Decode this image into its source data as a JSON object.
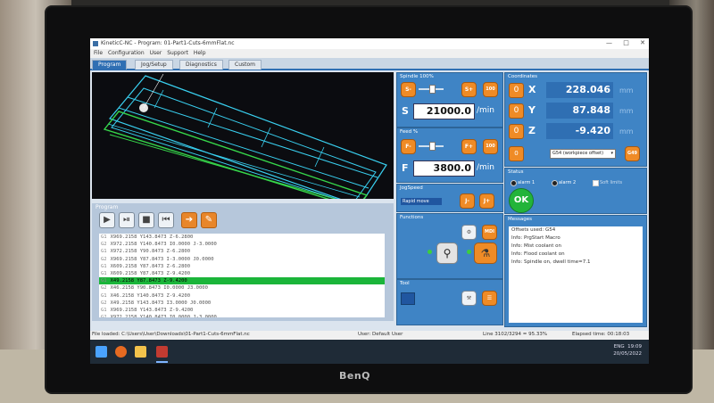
{
  "monitor_brand": "BenQ",
  "window": {
    "title": "KineticC-NC - Program: 01-Part1-Cuts-6mmFlat.nc",
    "min": "—",
    "max": "□",
    "close": "✕"
  },
  "menu": [
    "File",
    "Configuration",
    "User",
    "Support",
    "Help"
  ],
  "tabs": [
    "Program",
    "Jog/Setup",
    "Diagnostics",
    "Custom"
  ],
  "program": {
    "header": "Program",
    "buttons": [
      "run-icon",
      "step-icon",
      "stop-icon",
      "rewind-icon",
      "goto-icon",
      "edit-icon"
    ],
    "lines": [
      {
        "n": "G1",
        "code": "X969.2158 Y143.8473 Z-6.2800"
      },
      {
        "n": "G2",
        "code": "X972.2158 Y140.8473 I0.0000 J-3.0000"
      },
      {
        "n": "G1",
        "code": "X972.2158 Y90.8473 Z-6.2800"
      },
      {
        "n": "G2",
        "code": "X969.2158 Y87.8473 I-3.0000 J0.0000"
      },
      {
        "n": "G1",
        "code": "X609.2158 Y87.8473 Z-6.2800"
      },
      {
        "n": "G1",
        "code": "X609.2158 Y87.8473 Z-9.4200"
      },
      {
        "n": "G1",
        "code": "X49.2158 Y87.8473 Z-9.4200"
      },
      {
        "n": "G2",
        "code": "X46.2158 Y90.8473 I0.0000 J3.0000"
      },
      {
        "n": "G1",
        "code": "X46.2158 Y140.8473 Z-9.4200"
      },
      {
        "n": "G2",
        "code": "X49.2158 Y143.8473 I3.0000 J0.0000"
      },
      {
        "n": "G1",
        "code": "X969.2158 Y143.8473 Z-9.4200"
      },
      {
        "n": "G2",
        "code": "X972.2158 Y140.8473 I0.0000 J-3.0000"
      },
      {
        "n": "G1",
        "code": "X972.2158 Y90.8473 Z-9.4200"
      }
    ],
    "highlight_index": 6
  },
  "spindle": {
    "header": "Spindle 100%",
    "minus": "S-",
    "plus": "S+",
    "letter": "S",
    "value": "21000.0",
    "unit": "/min",
    "level": 0.55
  },
  "feed": {
    "header": "Feed %",
    "minus": "F-",
    "plus": "F+",
    "letter": "F",
    "value": "3800.0",
    "unit": "/min",
    "level": 0.55
  },
  "jog": {
    "header": "JogSpeed",
    "mode": "Rapid move",
    "minus": "J-",
    "plus": "J+"
  },
  "functions": {
    "header": "Functions",
    "mdi": "MDI"
  },
  "tool": {
    "header": "Tool"
  },
  "coordinates": {
    "header": "Coordinates",
    "axes": [
      {
        "label": "X",
        "value": "228.046",
        "unit": "mm",
        "zero": "0"
      },
      {
        "label": "Y",
        "value": "87.848",
        "unit": "mm",
        "zero": "0"
      },
      {
        "label": "Z",
        "value": "-9.420",
        "unit": "mm",
        "zero": "0"
      }
    ],
    "offset_select": "G54 (workpiece offset)",
    "g49": "G49",
    "zero_all": "0"
  },
  "status": {
    "header": "Status",
    "alarm1": "alarm 1",
    "alarm2": "alarm 2",
    "soft": "Soft limits",
    "ok": "OK"
  },
  "messages": {
    "header": "Messages",
    "items": [
      "Offsets used: G54",
      "Info: PrgStart Macro",
      "Info: Mist coolant on",
      "Info: Flood coolant on",
      "Info: Spindle on, dwell time=7.1"
    ]
  },
  "statusbar": {
    "file": "File loaded: C:\\Users\\User\\Downloads\\01-Part1-Cuts-6mmFlat.nc",
    "user": "User: Default User",
    "line": "Line 3102/3294 = 95.33%",
    "elapsed": "Elapsed time: 00:18:03"
  },
  "taskbar": {
    "lang": "ENG",
    "time": "19:09",
    "date": "20/05/2022"
  }
}
